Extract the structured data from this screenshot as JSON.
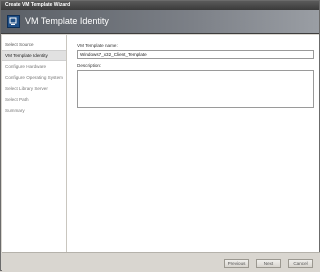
{
  "window": {
    "title": "Create VM Template Wizard"
  },
  "header": {
    "title": "VM Template Identity",
    "icon": "wizard-icon"
  },
  "sidebar": {
    "items": [
      {
        "label": "Select Source",
        "state": "done"
      },
      {
        "label": "VM Template Identity",
        "state": "active"
      },
      {
        "label": "Configure Hardware",
        "state": "pending"
      },
      {
        "label": "Configure Operating System",
        "state": "pending"
      },
      {
        "label": "Select Library Server",
        "state": "pending"
      },
      {
        "label": "Select Path",
        "state": "pending"
      },
      {
        "label": "Summary",
        "state": "pending"
      }
    ]
  },
  "form": {
    "name_label": "VM Template name:",
    "name_value": "Windows7_x32_Client_Template",
    "description_label": "Description:",
    "description_value": ""
  },
  "footer": {
    "previous_label": "Previous",
    "next_label": "Next",
    "cancel_label": "Cancel"
  },
  "colors": {
    "header_bg": "#6a6f76",
    "titlebar_bg": "#4a4a4a",
    "active_nav_bg": "#e1e1e1"
  }
}
